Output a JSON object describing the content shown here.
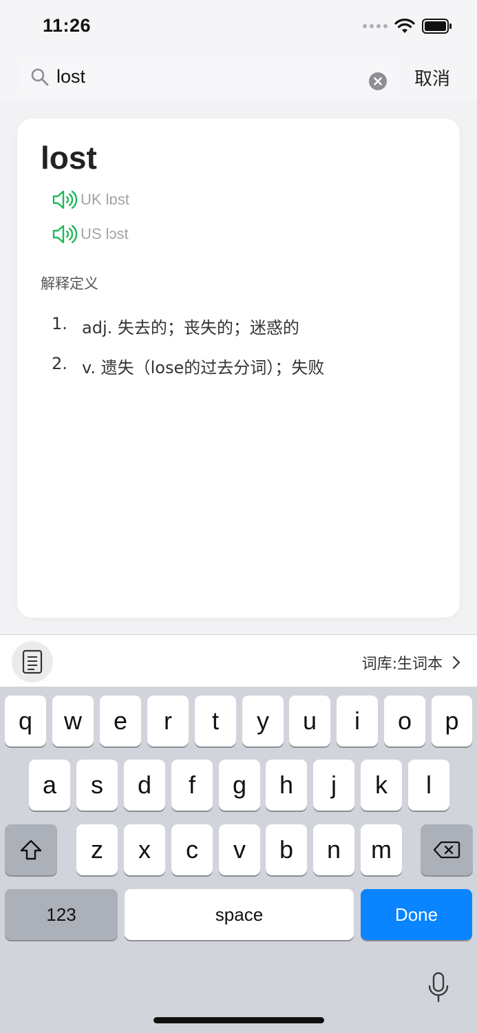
{
  "status_bar": {
    "time": "11:26"
  },
  "search": {
    "value": "lost",
    "cancel_label": "取消"
  },
  "entry": {
    "word": "lost",
    "pronunciations": [
      {
        "label": "UK lɒst"
      },
      {
        "label": "US lɔst"
      }
    ],
    "section_label": "解释定义",
    "definitions": [
      {
        "num": "1.",
        "text": "adj. 失去的；丧失的；迷惑的"
      },
      {
        "num": "2.",
        "text": "v. 遗失（lose的过去分词）；失败"
      }
    ]
  },
  "toolbar": {
    "library_label": "词库:生词本"
  },
  "keyboard": {
    "row1": [
      "q",
      "w",
      "e",
      "r",
      "t",
      "y",
      "u",
      "i",
      "o",
      "p"
    ],
    "row2": [
      "a",
      "s",
      "d",
      "f",
      "g",
      "h",
      "j",
      "k",
      "l"
    ],
    "row3": [
      "z",
      "x",
      "c",
      "v",
      "b",
      "n",
      "m"
    ],
    "numbers_label": "123",
    "space_label": "space",
    "done_label": "Done"
  },
  "colors": {
    "accent": "#0a84ff",
    "speaker": "#1fb85a"
  }
}
